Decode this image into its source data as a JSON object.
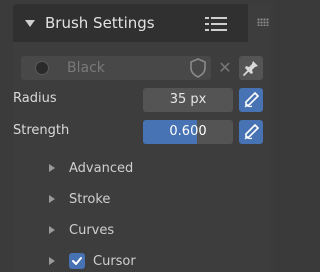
{
  "panel": {
    "title": "Brush Settings"
  },
  "brush": {
    "name": "Black"
  },
  "properties": {
    "radius_label": "Radius",
    "radius_value": "35 px",
    "strength_label": "Strength",
    "strength_value": "0.600",
    "strength_fraction": 0.6
  },
  "subpanels": [
    {
      "label": "Advanced"
    },
    {
      "label": "Stroke"
    },
    {
      "label": "Curves"
    },
    {
      "label": "Cursor",
      "checked": true
    }
  ],
  "icons": {
    "header_toggle": "triangle-down-icon",
    "menu": "list-menu-icon",
    "drag": "drag-grip-icon",
    "brush_preview": "circle-icon",
    "fake_user": "shield-icon",
    "unlink": "close-icon",
    "pin": "pin-icon",
    "pressure": "pen-pressure-icon"
  },
  "colors": {
    "accent": "#4772b3",
    "panel_bg": "#3d3d3d",
    "header_bg": "#303030"
  }
}
